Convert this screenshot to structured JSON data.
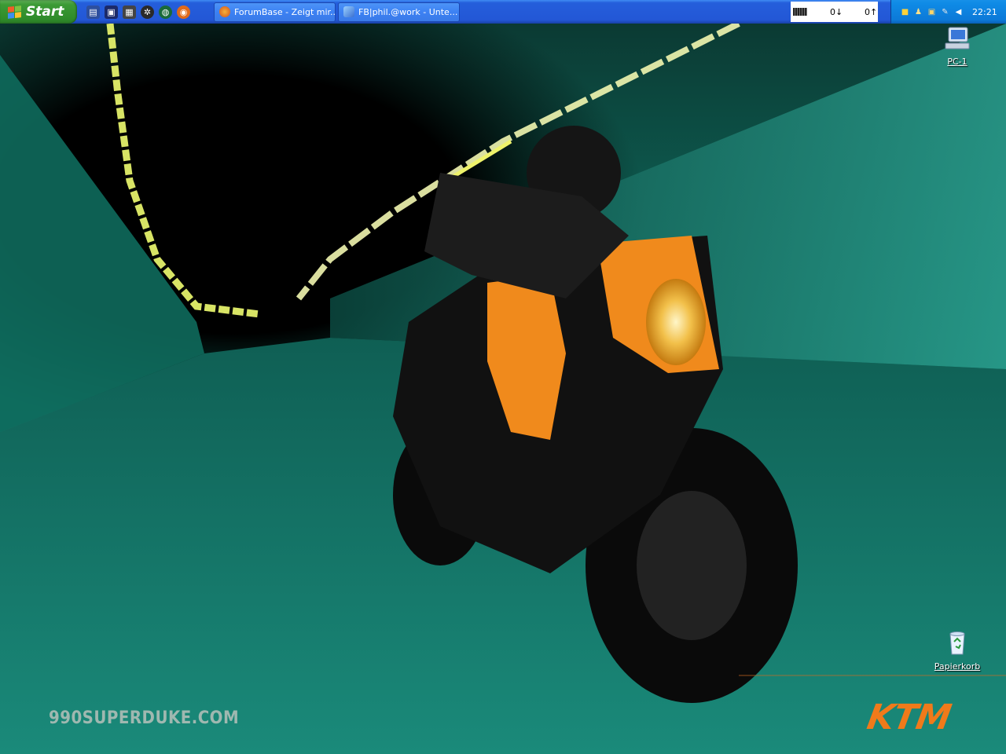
{
  "taskbar": {
    "start_label": "Start",
    "quick_launch": [
      {
        "icon": "save-floppy-icon"
      },
      {
        "icon": "floppy-disk-icon"
      },
      {
        "icon": "media-icon"
      },
      {
        "icon": "network-icon"
      },
      {
        "icon": "globe-icon"
      },
      {
        "icon": "firefox-icon"
      }
    ],
    "tasks": [
      {
        "label": "ForumBase - Zeigt mir...",
        "icon": "firefox-icon"
      },
      {
        "label": "FB|phil.@work - Unte...",
        "icon": "chat-icon"
      }
    ],
    "network": {
      "down": "0↓",
      "up": "0↑"
    },
    "tray_icons": [
      "monitor-tray-icon",
      "users-tray-icon",
      "network-tray-icon",
      "pen-tray-icon",
      "volume-icon"
    ],
    "clock": "22:21"
  },
  "desktop": {
    "icons": [
      {
        "label": "PC-1",
        "icon": "computer-icon"
      },
      {
        "label": "Papierkorb",
        "icon": "recycle-bin-icon"
      }
    ]
  },
  "wallpaper": {
    "caption": "990SUPERDUKE.COM",
    "brand": "KTM"
  },
  "colors": {
    "taskbar_blue": "#245edb",
    "start_green": "#3c9a35",
    "tray_blue": "#0f8be6",
    "ktm_orange": "#f07a1a",
    "tunnel_teal": "#138273"
  }
}
